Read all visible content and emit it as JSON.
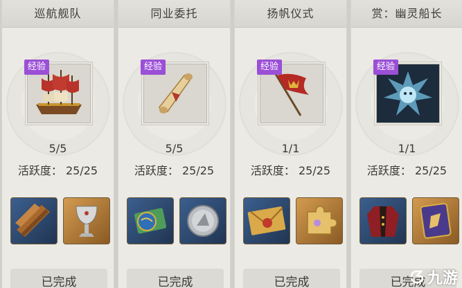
{
  "cards": [
    {
      "title": "巡航舰队",
      "tag": "经验",
      "progress": "5/5",
      "activity": "活跃度： 25/25",
      "status": "已完成",
      "icon": "galleon-ship-icon",
      "rewards": [
        "wood-planks-icon",
        "silver-goblet-icon"
      ]
    },
    {
      "title": "同业委托",
      "tag": "经验",
      "progress": "5/5",
      "activity": "活跃度： 25/25",
      "status": "已完成",
      "icon": "scroll-icon",
      "rewards": [
        "sea-chart-icon",
        "silver-coin-icon"
      ]
    },
    {
      "title": "扬帆仪式",
      "tag": "经验",
      "progress": "1/1",
      "activity": "活跃度： 25/25",
      "status": "已完成",
      "icon": "crown-flag-icon",
      "rewards": [
        "sealed-letter-icon",
        "puzzle-piece-icon"
      ]
    },
    {
      "title": "赏：幽灵船长",
      "tag": "经验",
      "progress": "1/1",
      "activity": "活跃度： 25/25",
      "status": "已完成",
      "icon": "ghost-captain-icon",
      "rewards": [
        "captain-coat-icon",
        "rune-card-icon"
      ]
    }
  ],
  "watermark": {
    "text": "九游",
    "icon": "nine-game-logo-icon"
  },
  "colors": {
    "exp_tag": "#9b4fd6",
    "card_bg": "#ebeae4",
    "reward_blue": "#2e4a70",
    "reward_gold": "#b57c3b"
  }
}
